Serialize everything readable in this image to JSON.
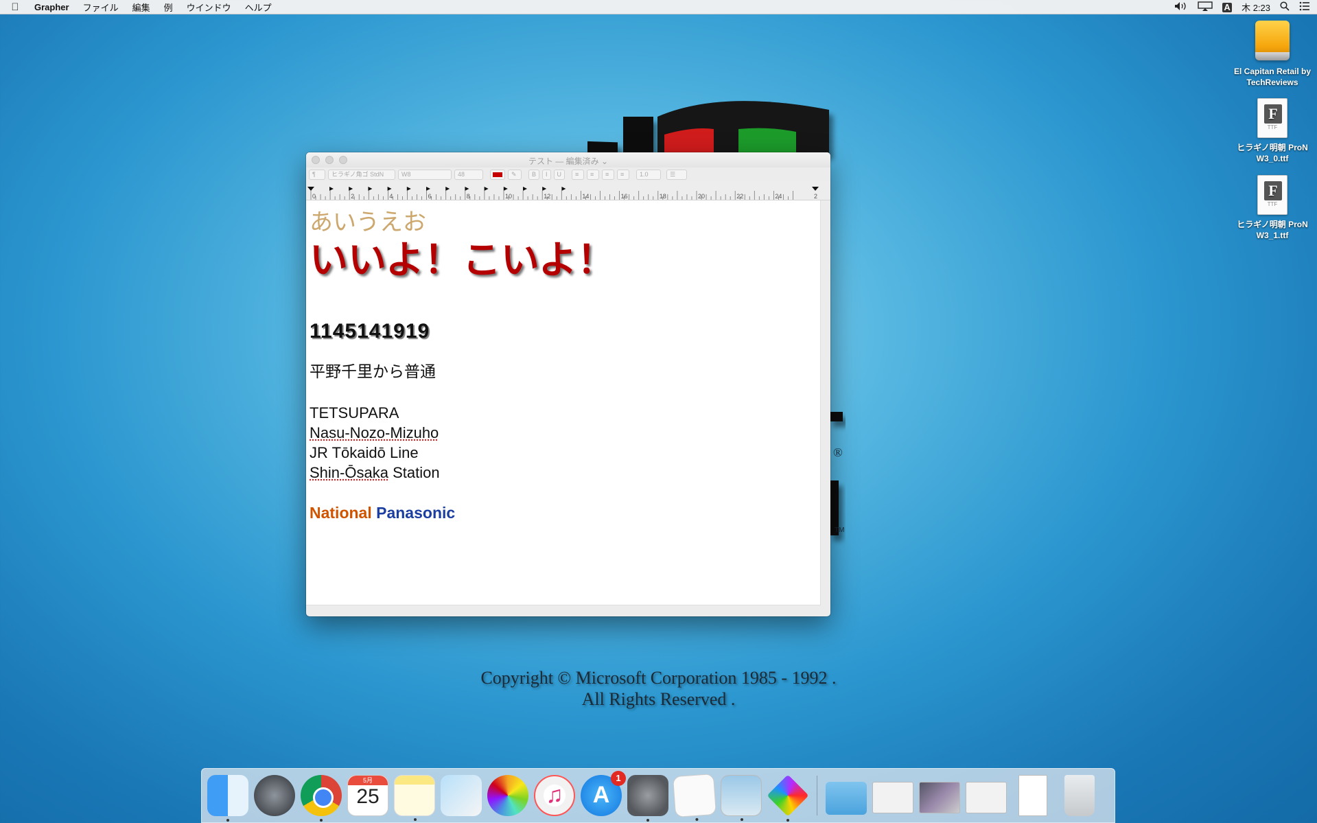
{
  "menubar": {
    "apple_symbol": "",
    "app_name": "Grapher",
    "items": [
      "ファイル",
      "編集",
      "例",
      "ウインドウ",
      "ヘルプ"
    ],
    "status": {
      "volume_icon": "volume-icon",
      "display_icon": "airplay-display-icon",
      "input_source": "A",
      "clock": "木 2:23",
      "spotlight_icon": "spotlight-search-icon",
      "notification_icon": "notification-center-icon"
    }
  },
  "background": {
    "copyright_line1": "Copyright © Microsoft Corporation 1985 - 1992 .",
    "copyright_line2": "All Rights Reserved .",
    "registered_mark": "®",
    "trademark_mark": "TM"
  },
  "desktop_icons": [
    {
      "label": "El Capitan Retail by TechReviews",
      "type": "drive"
    },
    {
      "label": "ヒラギノ明朝 ProN W3_0.ttf",
      "type": "font-file",
      "glyph": "F",
      "ext": "TTF"
    },
    {
      "label": "ヒラギノ明朝 ProN W3_1.ttf",
      "type": "font-file",
      "glyph": "F",
      "ext": "TTF"
    }
  ],
  "window": {
    "title": "テスト — 編集済み ⌄",
    "toolbar": {
      "paragraph_style": "¶",
      "font_family": "ヒラギノ角ゴ StdN",
      "font_weight": "W8",
      "font_size": "48",
      "text_color": "#c40000",
      "bold": "B",
      "italic": "I",
      "underline": "U",
      "line_spacing": "1.0",
      "list_menu": "☰"
    },
    "ruler_labels": [
      "0",
      "2",
      "4",
      "6",
      "8",
      "10",
      "12",
      "14",
      "16",
      "18",
      "20",
      "22",
      "24",
      "2"
    ],
    "document": {
      "line1": "あいうえお",
      "line2": "いいよ！こいよ！",
      "line3": "1145141919",
      "line4": "平野千里から普通",
      "line5": "TETSUPARA",
      "line6": "Nasu-Nozo-Mizuho",
      "line7_prefix": "JR Tōkaidō Line",
      "line8_word1": "Shin-Ōsaka",
      "line8_word2": " Station",
      "brand1": "National",
      "brand2": " Panasonic"
    }
  },
  "dock": {
    "apps": [
      {
        "name": "Finder",
        "running": true
      },
      {
        "name": "Launchpad",
        "running": false
      },
      {
        "name": "Google Chrome",
        "running": true
      },
      {
        "name": "Calendar",
        "running": false,
        "month": "5月",
        "day": "25"
      },
      {
        "name": "Notes",
        "running": true
      },
      {
        "name": "Preview Slideshow",
        "running": false
      },
      {
        "name": "Photos",
        "running": false
      },
      {
        "name": "iTunes",
        "running": false
      },
      {
        "name": "App Store",
        "running": false,
        "badge": "1"
      },
      {
        "name": "System Preferences",
        "running": true
      },
      {
        "name": "TextEdit",
        "running": true
      },
      {
        "name": "Preview",
        "running": true
      },
      {
        "name": "Grapher",
        "running": true
      }
    ],
    "stack_items": [
      "Downloads",
      "Screenshot 1",
      "Screenshot 2",
      "Screenshot 3",
      "Document",
      "Trash"
    ]
  }
}
